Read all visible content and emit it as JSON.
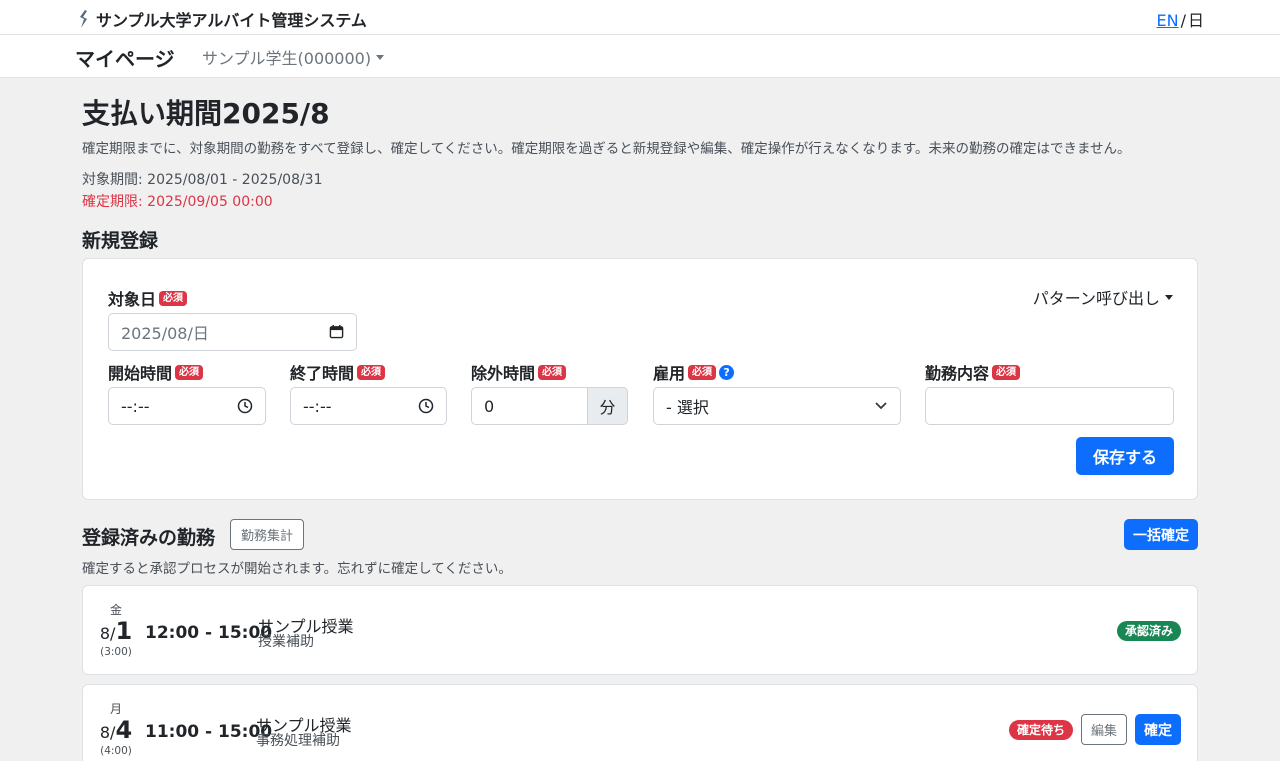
{
  "header": {
    "app_title": "サンプル大学アルバイト管理システム",
    "lang_en": "EN",
    "lang_sep": "/",
    "lang_ja": "日"
  },
  "nav": {
    "title": "マイページ",
    "user": "サンプル学生(000000)"
  },
  "page": {
    "title": "支払い期間2025/8",
    "description": "確定期限までに、対象期間の勤務をすべて登録し、確定してください。確定期限を過ぎると新規登録や編集、確定操作が行えなくなります。未来の勤務の確定はできません。",
    "period": "対象期間: 2025/08/01 - 2025/08/31",
    "deadline": "確定期限: 2025/09/05 00:00"
  },
  "new_entry": {
    "section_title": "新規登録",
    "required_label": "必須",
    "pattern_label": "パターン呼び出し",
    "date_label": "対象日",
    "date_value": "2025/08/日",
    "start_label": "開始時間",
    "start_value": "--:--",
    "end_label": "終了時間",
    "end_value": "--:--",
    "exclude_label": "除外時間",
    "exclude_value": "0",
    "exclude_unit": "分",
    "employment_label": "雇用",
    "employment_value": "- 選択",
    "content_label": "勤務内容",
    "content_value": "",
    "save_label": "保存する"
  },
  "registered": {
    "section_title": "登録済みの勤務",
    "summary_label": "勤務集計",
    "bulk_confirm_label": "一括確定",
    "description": "確定すると承認プロセスが開始されます。忘れずに確定してください。",
    "items": [
      {
        "dow": "金",
        "month": "8/",
        "day": "1",
        "duration": "(3:00)",
        "time": "12:00 - 15:00",
        "course": "サンプル授業",
        "task": "授業補助",
        "status": "承認済み",
        "status_color": "#198754"
      },
      {
        "dow": "月",
        "month": "8/",
        "day": "4",
        "duration": "(4:00)",
        "time": "11:00 - 15:00",
        "course": "サンプル授業",
        "task": "事務処理補助",
        "status": "確定待ち",
        "status_color": "#dc3545",
        "edit_label": "編集",
        "confirm_label": "確定"
      }
    ]
  },
  "colors": {
    "primary": "#0d6efd",
    "danger": "#dc3545",
    "success": "#198754",
    "background": "#f0f0f1"
  }
}
